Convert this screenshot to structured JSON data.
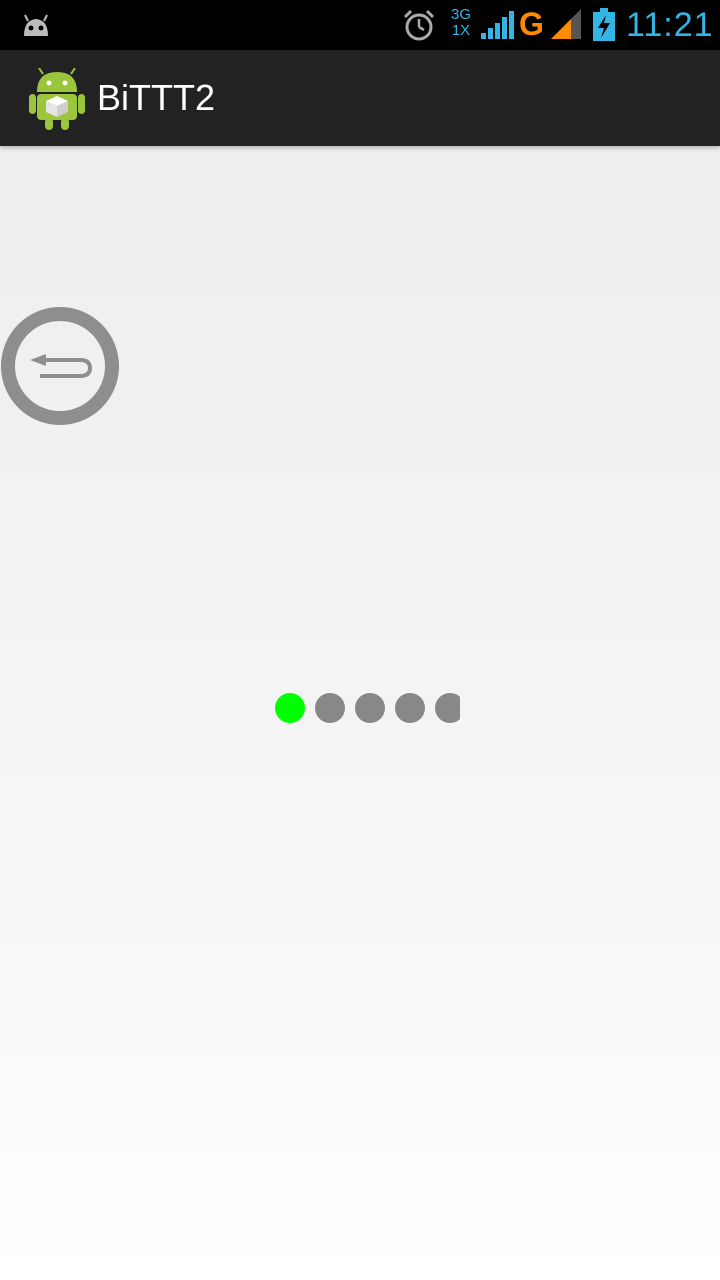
{
  "status_bar": {
    "network_top": "3G",
    "network_bottom": "1X",
    "data_type": "G",
    "time": "11:21"
  },
  "action_bar": {
    "title": "BiTTT2",
    "icon": "android-app-icon"
  },
  "main": {
    "back_button_icon": "back-arrow-icon",
    "page_indicator": {
      "total_visible": 5,
      "active_index": 0,
      "active_color": "#00ff00",
      "inactive_color": "#888888"
    }
  },
  "colors": {
    "status_accent": "#33b5e5",
    "data_type": "#ff8a00",
    "action_bar_bg": "#222222"
  }
}
